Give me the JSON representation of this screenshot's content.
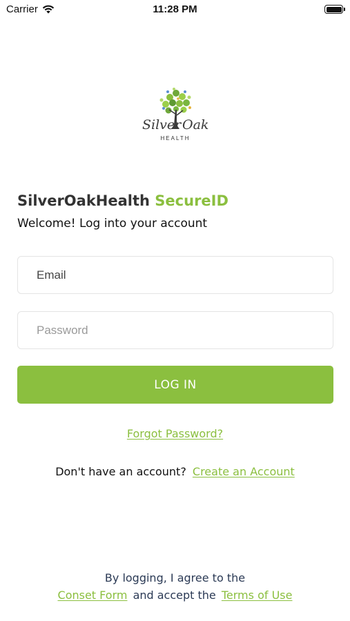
{
  "status_bar": {
    "carrier": "Carrier",
    "time": "11:28 PM"
  },
  "logo": {
    "name": "Silver Oak",
    "subtext": "HEALTH",
    "icon": "oak-tree-icon"
  },
  "header": {
    "brand": "SilverOakHealth",
    "brand_accent": "SecureID",
    "subtitle": "Welcome! Log into your account"
  },
  "form": {
    "email_placeholder": "Email",
    "password_placeholder": "Password",
    "login_label": "LOG IN"
  },
  "links": {
    "forgot_password": "Forgot Password?",
    "no_account": "Don't have an account?",
    "create_account": "Create an Account"
  },
  "legal": {
    "line1": "By logging, I agree to the",
    "consent_link": "Conset Form",
    "middle": "and accept the",
    "terms_link": "Terms of Use"
  },
  "colors": {
    "accent": "#8bbf3f",
    "text_dark": "#333333",
    "legal_text": "#2b3a55"
  }
}
